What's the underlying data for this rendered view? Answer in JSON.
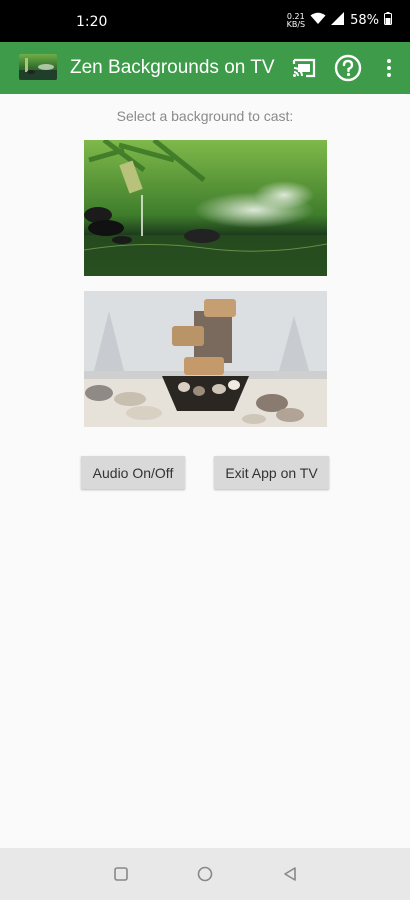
{
  "status_bar": {
    "time": "1:20",
    "network_label_top": "0.21",
    "network_label_bottom": "KB/S",
    "battery": "58%"
  },
  "app_bar": {
    "title": "Zen Backgrounds on TV",
    "icons": [
      "app-logo",
      "cast-icon",
      "help-icon",
      "more-vert-icon"
    ]
  },
  "main": {
    "prompt": "Select a background to cast:",
    "backgrounds": [
      {
        "name": "bamboo-water-mist"
      },
      {
        "name": "stone-fountain-snow"
      }
    ],
    "buttons": {
      "audio": "Audio On/Off",
      "exit": "Exit App on TV"
    }
  },
  "nav_bar": {
    "icons": [
      "recents-square-icon",
      "home-circle-icon",
      "back-triangle-icon"
    ]
  },
  "colors": {
    "app_bar": "#3e9b4a",
    "background": "#fafafa",
    "button": "#d9d9d9",
    "nav_bar": "#e8e8e8"
  }
}
